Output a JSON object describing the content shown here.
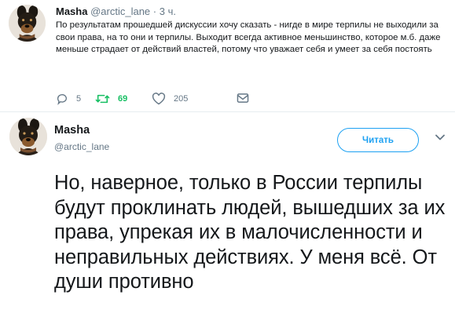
{
  "quoted_tweet": {
    "author_name": "Masha",
    "handle": "@arctic_lane",
    "separator": "·",
    "time": "3 ч.",
    "text": "По результатам прошедшей дискуссии хочу сказать - нигде в мире терпилы не выходили за свои права, на то они и терпилы. Выходит всегда активное меньшинство, которое м.б. даже меньше страдает от действий властей, потому что уважает себя и умеет за себя постоять",
    "actions": {
      "reply_icon": "reply-icon",
      "reply_count": "5",
      "retweet_icon": "retweet-icon",
      "retweet_count": "69",
      "retweet_color": "#17bf63",
      "like_icon": "heart-icon",
      "like_count": "205",
      "dm_icon": "envelope-icon"
    }
  },
  "main_tweet": {
    "author_name": "Masha",
    "handle": "@arctic_lane",
    "follow_label": "Читать",
    "follow_color": "#1da1f2",
    "menu_icon": "chevron-down-icon",
    "text": "Но, наверное, только в России терпилы будут проклинать людей, вышедших за их права, упрекая их в малочисленности и неправильных действиях. У меня всё. От души противно"
  }
}
